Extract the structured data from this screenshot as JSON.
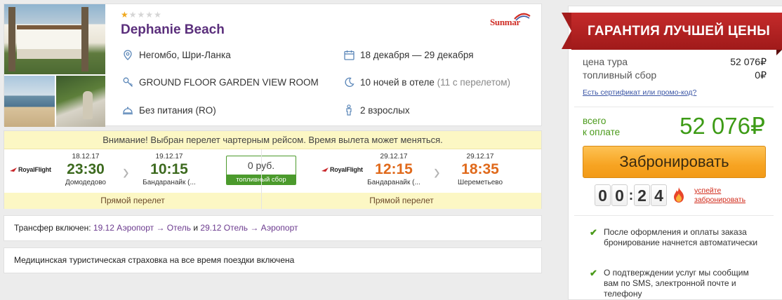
{
  "hotel": {
    "stars": 1,
    "stars_max": 5,
    "name": "Dephanie Beach",
    "operator": "Sunmar",
    "location": "Негомбо, Шри-Ланка",
    "dates": "18 декабря — 29 декабря",
    "room": "GROUND FLOOR GARDEN VIEW ROOM",
    "nights": "10 ночей в отеле",
    "nights_note": "(11 с перелетом)",
    "meal": "Без питания (RO)",
    "guests": "2 взрослых"
  },
  "flight": {
    "warning": "Внимание! Выбран перелет чартерным рейсом. Время вылета может меняться.",
    "fuel_price": "0 руб.",
    "fuel_label": "топливный сбор",
    "outbound": {
      "airline": "RoyalFlight",
      "dep_date": "18.12.17",
      "dep_time": "23:30",
      "dep_airport": "Домодедово",
      "arr_date": "19.12.17",
      "arr_time": "10:15",
      "arr_airport": "Бандаранайк (...",
      "type": "Прямой перелет"
    },
    "return": {
      "airline": "RoyalFlight",
      "dep_date": "29.12.17",
      "dep_time": "12:15",
      "dep_airport": "Бандаранайк (...",
      "arr_date": "29.12.17",
      "arr_time": "18:35",
      "arr_airport": "Шереметьево",
      "type": "Прямой перелет"
    }
  },
  "transfer": {
    "prefix": "Трансфер включен:",
    "leg1_date": "19.12",
    "leg1_route": "Аэропорт → Отель",
    "joiner": "и",
    "leg2_date": "29.12",
    "leg2_route": "Отель → Аэропорт"
  },
  "insurance": "Медицинская туристическая страховка на все время поездки включена",
  "sidebar": {
    "banner": "ГАРАНТИЯ ЛУЧШЕЙ ЦЕНЫ",
    "tour_price_label": "цена тура",
    "tour_price": "52 076₽",
    "fuel_label": "топливный сбор",
    "fuel_value": "0₽",
    "promo_link": "Есть сертификат или промо-код?",
    "total_label_1": "всего",
    "total_label_2": "к оплате",
    "total_value": "52 076₽",
    "book_button": "Забронировать",
    "timer": {
      "d1": "0",
      "d2": "0",
      "d3": "2",
      "d4": "4"
    },
    "hurry_1": "успейте",
    "hurry_2": "забронировать",
    "note_1": "После оформления и оплаты заказа бронирование начнется автоматически",
    "note_2": "О подтверждении услуг мы сообщим вам по SMS, электронной почте и телефону"
  },
  "colors": {
    "hotel_name": "#5b2f7c",
    "accent_green": "#3d9b16",
    "time_outbound": "#3d6a1f",
    "time_return": "#e06a1c",
    "banner_red": "#b52323",
    "button_orange": "#f7a422"
  },
  "icons": [
    "map-pin-icon",
    "calendar-icon",
    "key-icon",
    "moon-icon",
    "cloche-icon",
    "person-icon",
    "fire-icon",
    "check-icon"
  ]
}
